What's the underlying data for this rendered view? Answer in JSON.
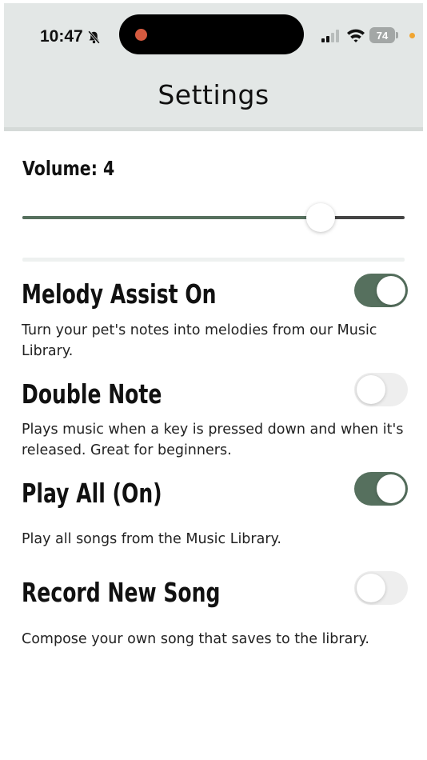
{
  "status_bar": {
    "time": "10:47",
    "battery": "74",
    "icons": [
      "bell-slash-icon",
      "signal-icon",
      "wifi-icon",
      "battery-icon"
    ]
  },
  "header": {
    "title": "Settings"
  },
  "volume": {
    "label": "Volume: 4",
    "value_fraction": 0.78
  },
  "settings": [
    {
      "title": "Melody Assist On",
      "description": "Turn your pet's notes into melodies from our Music Library.",
      "enabled": true
    },
    {
      "title": "Double Note",
      "description": "Plays music when a key is pressed down and when it's released. Great for beginners.",
      "enabled": false
    },
    {
      "title": "Play All (On)",
      "description": "Play all songs from the Music Library.",
      "enabled": true
    },
    {
      "title": "Record New Song",
      "description": "Compose your own song that saves to the library.",
      "enabled": false
    }
  ],
  "colors": {
    "accent": "#56705e",
    "header_bg": "#e3e7e6",
    "toggle_off": "#eeeeee"
  }
}
